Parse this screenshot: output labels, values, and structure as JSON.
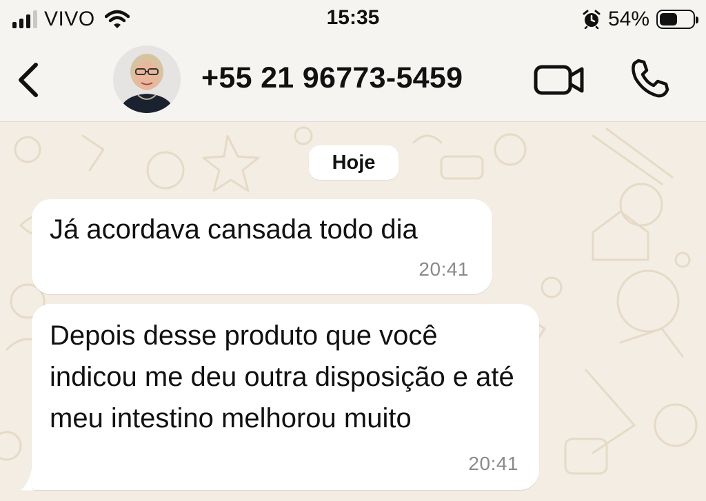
{
  "status_bar": {
    "carrier": "VIVO",
    "time": "15:35",
    "battery_percent": "54%",
    "battery_level": 0.54,
    "signal_bars_active": 3,
    "signal_bars_total": 4,
    "icons": [
      "signal-icon",
      "wifi-icon",
      "alarm-icon",
      "battery-icon"
    ]
  },
  "header": {
    "back_icon": "chevron-left-icon",
    "contact_name": "+55 21 96773-5459",
    "actions": [
      "video-call-icon",
      "phone-call-icon"
    ]
  },
  "chat": {
    "date_separator": "Hoje",
    "messages": [
      {
        "text": "Já acordava cansada todo dia",
        "time": "20:41",
        "direction": "incoming"
      },
      {
        "text": "Depois desse produto que você indicou me deu outra disposição e até meu intestino melhorou muito",
        "time": "20:41",
        "direction": "incoming"
      }
    ]
  },
  "colors": {
    "chat_background": "#f3ede3",
    "bubble_incoming": "#ffffff",
    "timestamp": "#8a8a8a",
    "header_background": "#f6f4f0"
  }
}
